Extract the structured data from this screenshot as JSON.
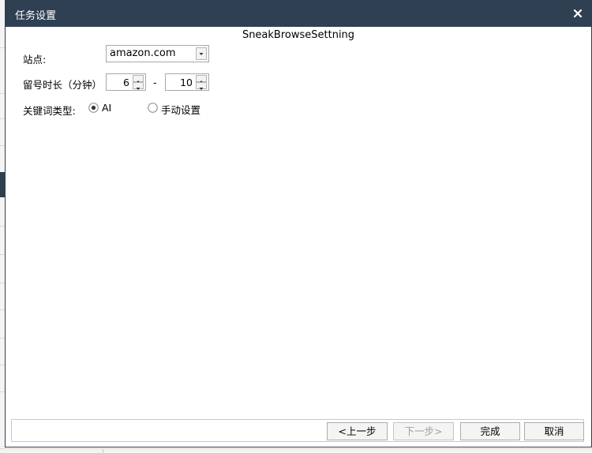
{
  "dialog": {
    "title": "任务设置",
    "subtitle": "SneakBrowseSettning",
    "close_icon": "close-icon"
  },
  "form": {
    "site": {
      "label": "站点:",
      "value": "amazon.com"
    },
    "duration": {
      "label": "留号时长（分钟）",
      "min": "6",
      "separator": "-",
      "max": "10"
    },
    "keyword_type": {
      "label": "关键词类型:",
      "options": [
        {
          "label": "AI",
          "selected": true
        },
        {
          "label": "手动设置",
          "selected": false
        }
      ]
    }
  },
  "buttons": {
    "prev": "<上一步",
    "next": "下一步>",
    "finish": "完成",
    "cancel": "取消"
  },
  "colors": {
    "titlebar": "#2e4052",
    "sidebar_selected": "#2f3f4f"
  }
}
